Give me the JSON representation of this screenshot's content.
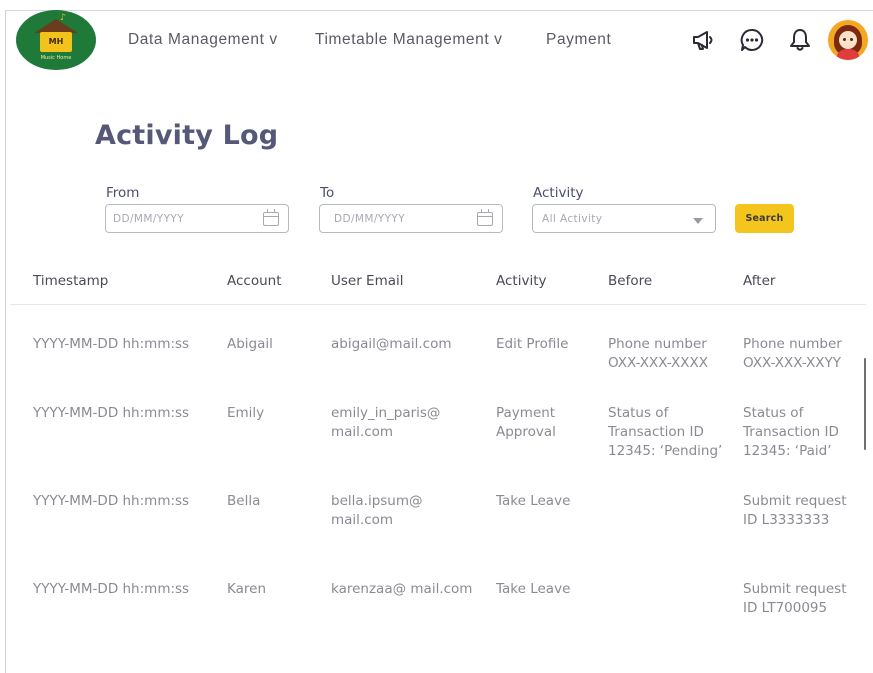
{
  "logo": {
    "initials": "MH",
    "tagline": "Music Home",
    "note": "♪"
  },
  "nav": {
    "items": [
      {
        "label": "Data Management v"
      },
      {
        "label": "Timetable Management v"
      },
      {
        "label": "Payment"
      }
    ],
    "icons": [
      "megaphone-icon",
      "chat-icon",
      "bell-icon"
    ],
    "avatar": "user-avatar"
  },
  "page": {
    "title": "Activity Log"
  },
  "filters": {
    "from": {
      "label": "From",
      "placeholder": "DD/MM/YYYY"
    },
    "to": {
      "label": "To",
      "placeholder": "DD/MM/YYYY"
    },
    "activity": {
      "label": "Activity",
      "selected": "All Activity"
    },
    "search_label": "Search"
  },
  "table": {
    "columns": [
      "Timestamp",
      "Account",
      "User Email",
      "Activity",
      "Before",
      "After"
    ],
    "rows": [
      {
        "timestamp": "YYYY-MM-DD hh:mm:ss",
        "account": "Abigail",
        "email": [
          "abigail@mail.com"
        ],
        "activity": [
          "Edit Profile"
        ],
        "before": [
          "Phone number",
          "OXX-XXX-XXXX"
        ],
        "after": [
          "Phone number",
          "OXX-XXX-XXYY"
        ]
      },
      {
        "timestamp": "YYYY-MM-DD hh:mm:ss",
        "account": "Emily",
        "email": [
          "emily_in_paris@",
          "mail.com"
        ],
        "activity": [
          "Payment",
          "Approval"
        ],
        "before": [
          "Status of",
          "Transaction ID",
          "12345: ‘Pending’"
        ],
        "after": [
          "Status of",
          "Transaction ID",
          "12345: ‘Paid’"
        ]
      },
      {
        "timestamp": "YYYY-MM-DD hh:mm:ss",
        "account": "Bella",
        "email": [
          "bella.ipsum@",
          "mail.com"
        ],
        "activity": [
          "Take Leave"
        ],
        "before": [],
        "after": [
          "Submit request",
          "ID L3333333"
        ]
      },
      {
        "timestamp": "YYYY-MM-DD hh:mm:ss",
        "account": "Karen",
        "email": [
          "karenzaa@ mail.com"
        ],
        "activity": [
          "Take Leave"
        ],
        "before": [],
        "after": [
          "Submit request",
          "ID LT700095"
        ]
      }
    ]
  },
  "colors": {
    "accent": "#f4c51d",
    "title": "#555878",
    "logo_bg": "#1f7a3a"
  }
}
